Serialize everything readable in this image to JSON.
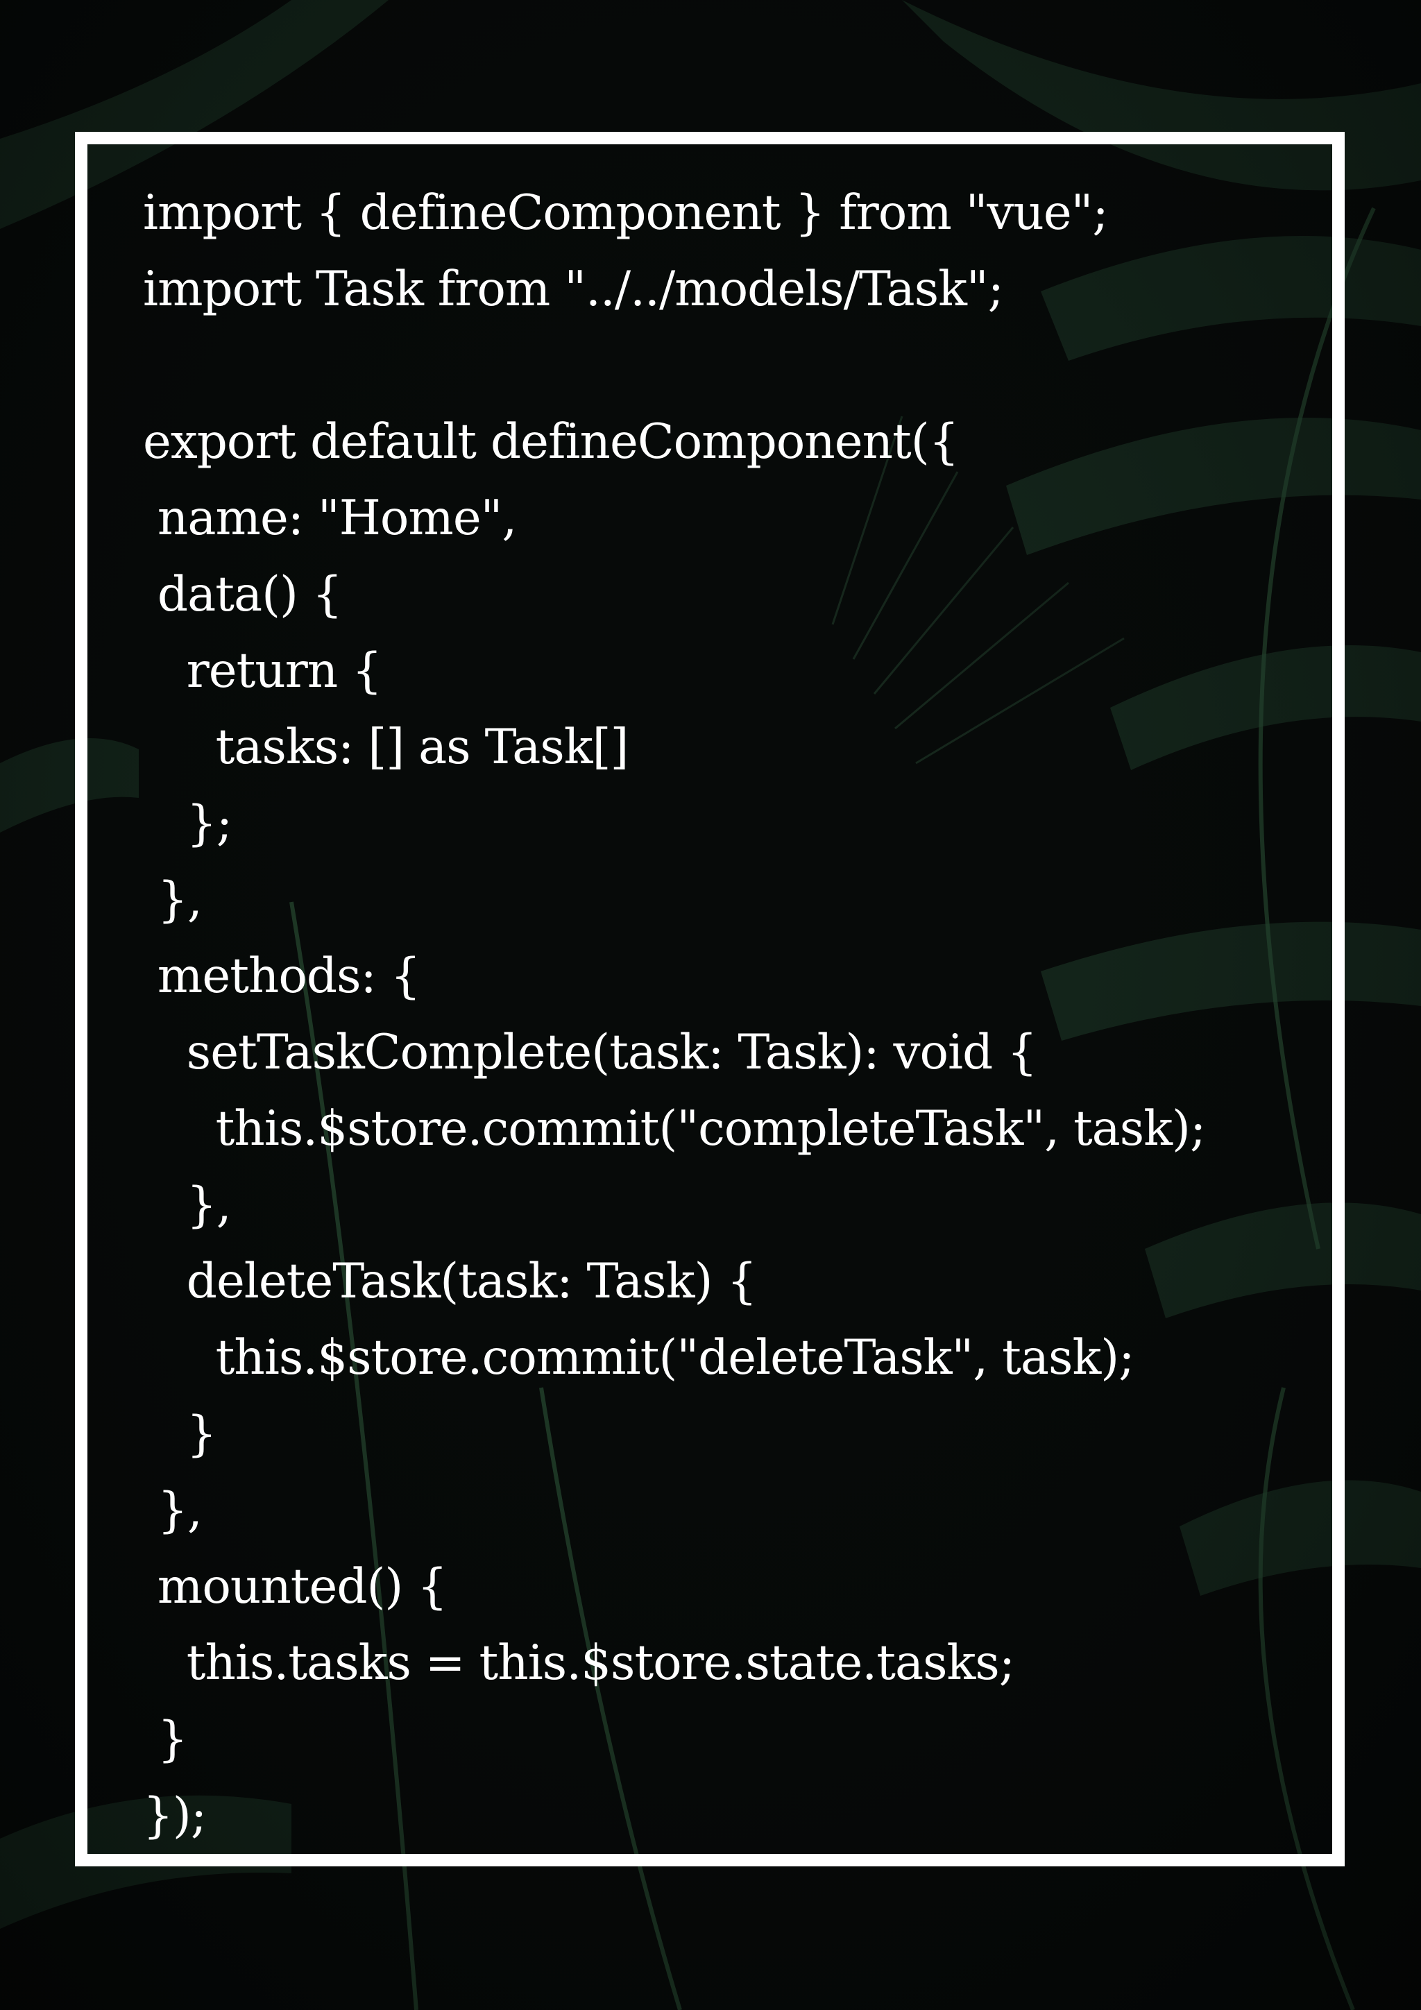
{
  "colors": {
    "background": "#070a09",
    "leaf": "#1f3a2a",
    "leaf_light": "#2f5a3c",
    "frame": "#ffffff",
    "text": "#ffffff"
  },
  "code_lines": [
    "import { defineComponent } from \"vue\";",
    "import Task from \"../../models/Task\";",
    "",
    "export default defineComponent({",
    " name: \"Home\",",
    " data() {",
    "   return {",
    "     tasks: [] as Task[]",
    "   };",
    " },",
    " methods: {",
    "   setTaskComplete(task: Task): void {",
    "     this.$store.commit(\"completeTask\", task);",
    "   },",
    "   deleteTask(task: Task) {",
    "     this.$store.commit(\"deleteTask\", task);",
    "   }",
    " },",
    " mounted() {",
    "   this.tasks = this.$store.state.tasks;",
    " }",
    "});"
  ]
}
